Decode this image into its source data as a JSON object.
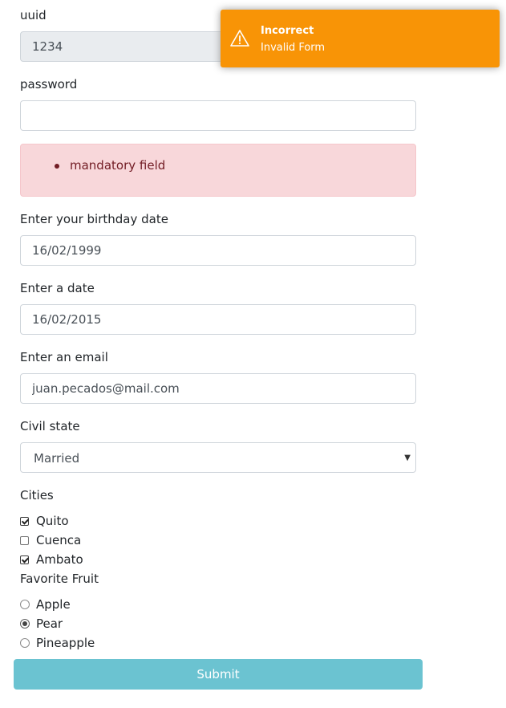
{
  "form": {
    "uuid": {
      "label": "uuid",
      "value": "1234"
    },
    "password": {
      "label": "password",
      "value": ""
    },
    "password_errors": [
      "mandatory field"
    ],
    "birthday": {
      "label": "Enter your birthday date",
      "value": "16/02/1999"
    },
    "date": {
      "label": "Enter a date",
      "value": "16/02/2015"
    },
    "email": {
      "label": "Enter an email",
      "value": "juan.pecados@mail.com"
    },
    "civil_state": {
      "label": "Civil state",
      "selected": "Married"
    },
    "cities": {
      "label": "Cities",
      "options": [
        {
          "label": "Quito",
          "checked": true
        },
        {
          "label": "Cuenca",
          "checked": false
        },
        {
          "label": "Ambato",
          "checked": true
        }
      ]
    },
    "fruit": {
      "label": "Favorite Fruit",
      "options": [
        {
          "label": "Apple",
          "selected": false
        },
        {
          "label": "Pear",
          "selected": true
        },
        {
          "label": "Pineapple",
          "selected": false
        }
      ]
    },
    "submit_label": "Submit"
  },
  "toast": {
    "title": "Incorrect",
    "message": "Invalid Form",
    "icon": "warning-triangle-icon",
    "color": "#f89406"
  },
  "colors": {
    "error_bg": "#f8d7da",
    "error_text": "#721c24",
    "submit_bg": "#6bc3d1"
  }
}
